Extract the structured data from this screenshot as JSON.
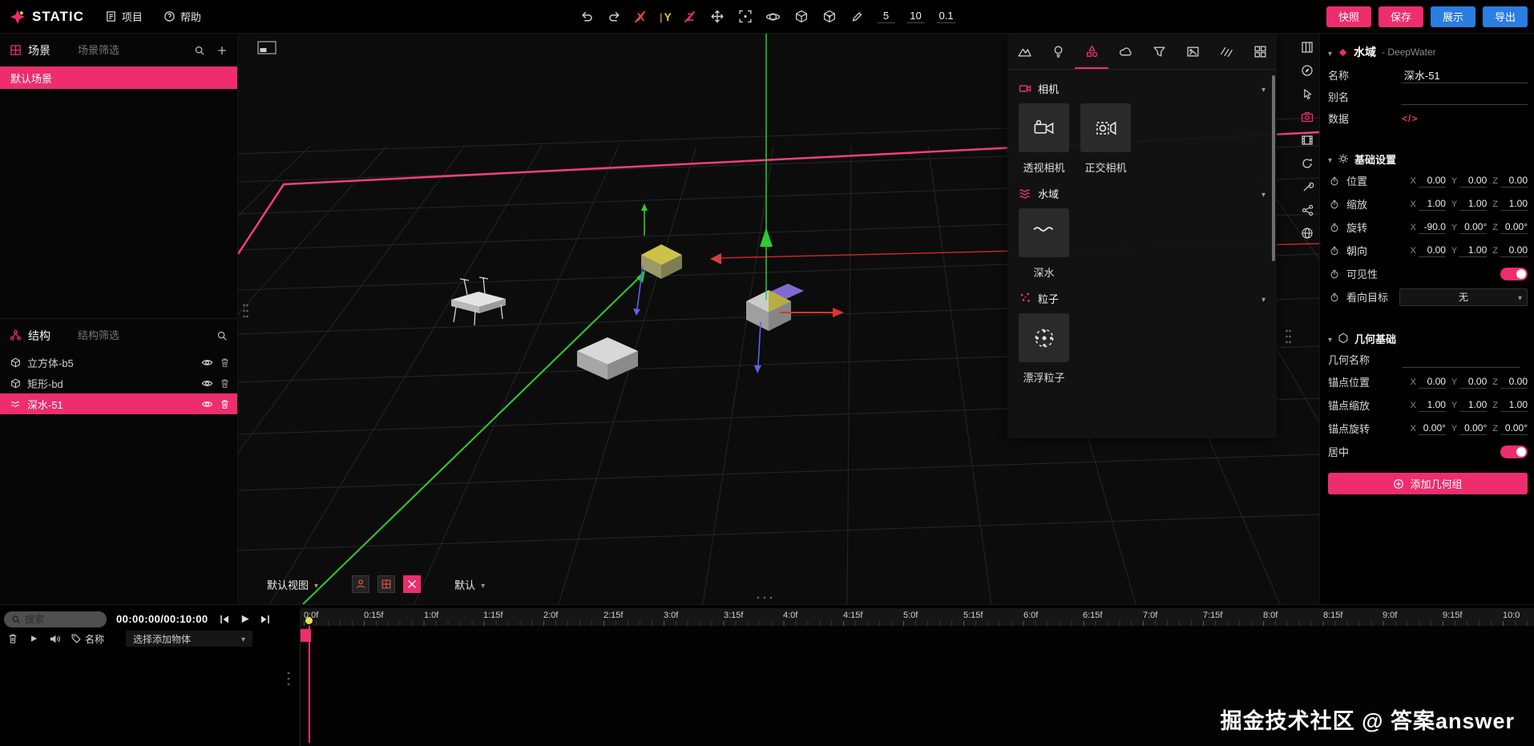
{
  "topbar": {
    "logo_text": "STATIC",
    "project_menu": "项目",
    "help_menu": "帮助",
    "axis_x": "X",
    "axis_y": "Y",
    "axis_z": "Z",
    "snap_move": "5",
    "snap_grid": "10",
    "snap_step": "0.1",
    "btn_snapshot": "快照",
    "btn_save": "保存",
    "btn_present": "展示",
    "btn_export": "导出"
  },
  "sidebar": {
    "scene_title": "场景",
    "scene_filter_placeholder": "场景筛选",
    "scene_items": [
      {
        "label": "默认场景"
      }
    ],
    "structure_title": "结构",
    "structure_filter_placeholder": "结构筛选",
    "structure_items": [
      {
        "label": "立方体-b5"
      },
      {
        "label": "矩形-bd"
      },
      {
        "label": "深水-51"
      }
    ]
  },
  "viewport": {
    "view_select": "默认视图",
    "preset_select": "默认"
  },
  "library": {
    "sections": [
      {
        "title": "相机",
        "items": [
          {
            "label": "透视相机"
          },
          {
            "label": "正交相机"
          }
        ]
      },
      {
        "title": "水域",
        "items": [
          {
            "label": "深水"
          }
        ]
      },
      {
        "title": "粒子",
        "items": [
          {
            "label": "漂浮粒子"
          }
        ]
      }
    ]
  },
  "properties": {
    "type_title": "水域",
    "type_suffix": "- DeepWater",
    "name_label": "名称",
    "name_value": "深水-51",
    "alias_label": "别名",
    "data_label": "数据",
    "data_code": "</>",
    "axis": {
      "x": "X",
      "y": "Y",
      "z": "Z"
    },
    "basic_title": "基础设置",
    "rows": [
      {
        "label": "位置",
        "x": "0.00",
        "y": "0.00",
        "z": "0.00"
      },
      {
        "label": "缩放",
        "x": "1.00",
        "y": "1.00",
        "z": "1.00"
      },
      {
        "label": "旋转",
        "x": "-90.0",
        "y": "0.00°",
        "z": "0.00°"
      },
      {
        "label": "朝向",
        "x": "0.00",
        "y": "1.00",
        "z": "0.00"
      }
    ],
    "visibility_label": "可见性",
    "target_label": "看向目标",
    "target_value": "无",
    "geometry_title": "几何基础",
    "geo_name_label": "几何名称",
    "anchor_rows": [
      {
        "label": "锚点位置",
        "x": "0.00",
        "y": "0.00",
        "z": "0.00"
      },
      {
        "label": "锚点缩放",
        "x": "1.00",
        "y": "1.00",
        "z": "1.00"
      },
      {
        "label": "锚点旋转",
        "x": "0.00°",
        "y": "0.00°",
        "z": "0.00°"
      }
    ],
    "center_label": "居中",
    "add_geometry_button": "添加几何组"
  },
  "timeline": {
    "search_placeholder": "搜索",
    "time_display": "00:00:00/00:10:00",
    "name_label": "名称",
    "add_object_select": "选择添加物体",
    "ticks": [
      "0:0f",
      "0:15f",
      "1:0f",
      "1:15f",
      "2:0f",
      "2:15f",
      "3:0f",
      "3:15f",
      "4:0f",
      "4:15f",
      "5:0f",
      "5:15f",
      "6:0f",
      "6:15f",
      "7:0f",
      "7:15f",
      "8:0f",
      "8:15f",
      "9:0f",
      "9:15f",
      "10:0"
    ]
  },
  "watermark": "掘金技术社区 @ 答案answer"
}
